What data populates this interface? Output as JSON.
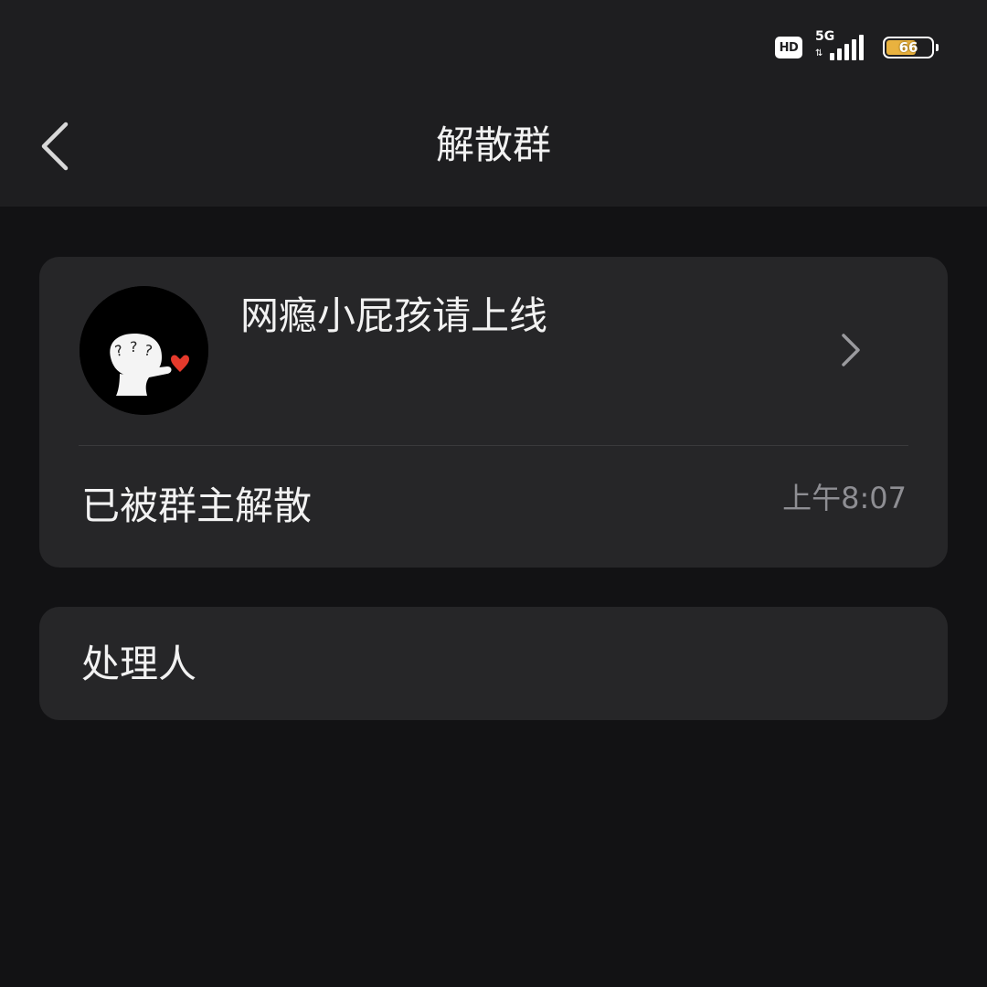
{
  "status_bar": {
    "hd": "HD",
    "network": "5G",
    "battery_level": "66",
    "battery_fraction": 0.66,
    "battery_color": "#e9b23f"
  },
  "nav": {
    "back_icon": "chevron-left-icon",
    "title": "解散群"
  },
  "group": {
    "name": "网瘾小屁孩请上线",
    "avatar_icon": "question-face-sticker",
    "chevron_icon": "chevron-right-icon",
    "status": "已被群主解散",
    "time": "上午8:07"
  },
  "handler": {
    "label": "处理人"
  },
  "colors": {
    "background": "#121214",
    "header": "#1e1e20",
    "card": "#262628",
    "text": "#f2f2f2",
    "secondary_text": "#8e8e93"
  }
}
